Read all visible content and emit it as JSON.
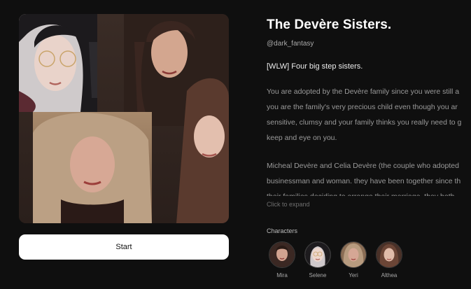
{
  "cover": {
    "alt": "Collage of four women"
  },
  "start_button": {
    "label": "Start"
  },
  "bot": {
    "title": "The Devère Sisters.",
    "handle": "@dark_fantasy",
    "tagline": "[WLW] Four big step sisters.",
    "description_lines": [
      "You are adopted by the Devère family since you were still a",
      "you are the family's very precious child even though you ar",
      "sensitive, clumsy and your family thinks you really need to g",
      "keep and eye on you.",
      "Micheal Devère and Celia Devère (the couple who adopted",
      "businessman and woman. they have been together since th",
      "their families deciding to arrange their marriage, they both"
    ],
    "expand_label": "Click to expand"
  },
  "characters": {
    "label": "Characters",
    "items": [
      {
        "name": "Mira"
      },
      {
        "name": "Selene"
      },
      {
        "name": "Yeri"
      },
      {
        "name": "Althea"
      }
    ]
  }
}
